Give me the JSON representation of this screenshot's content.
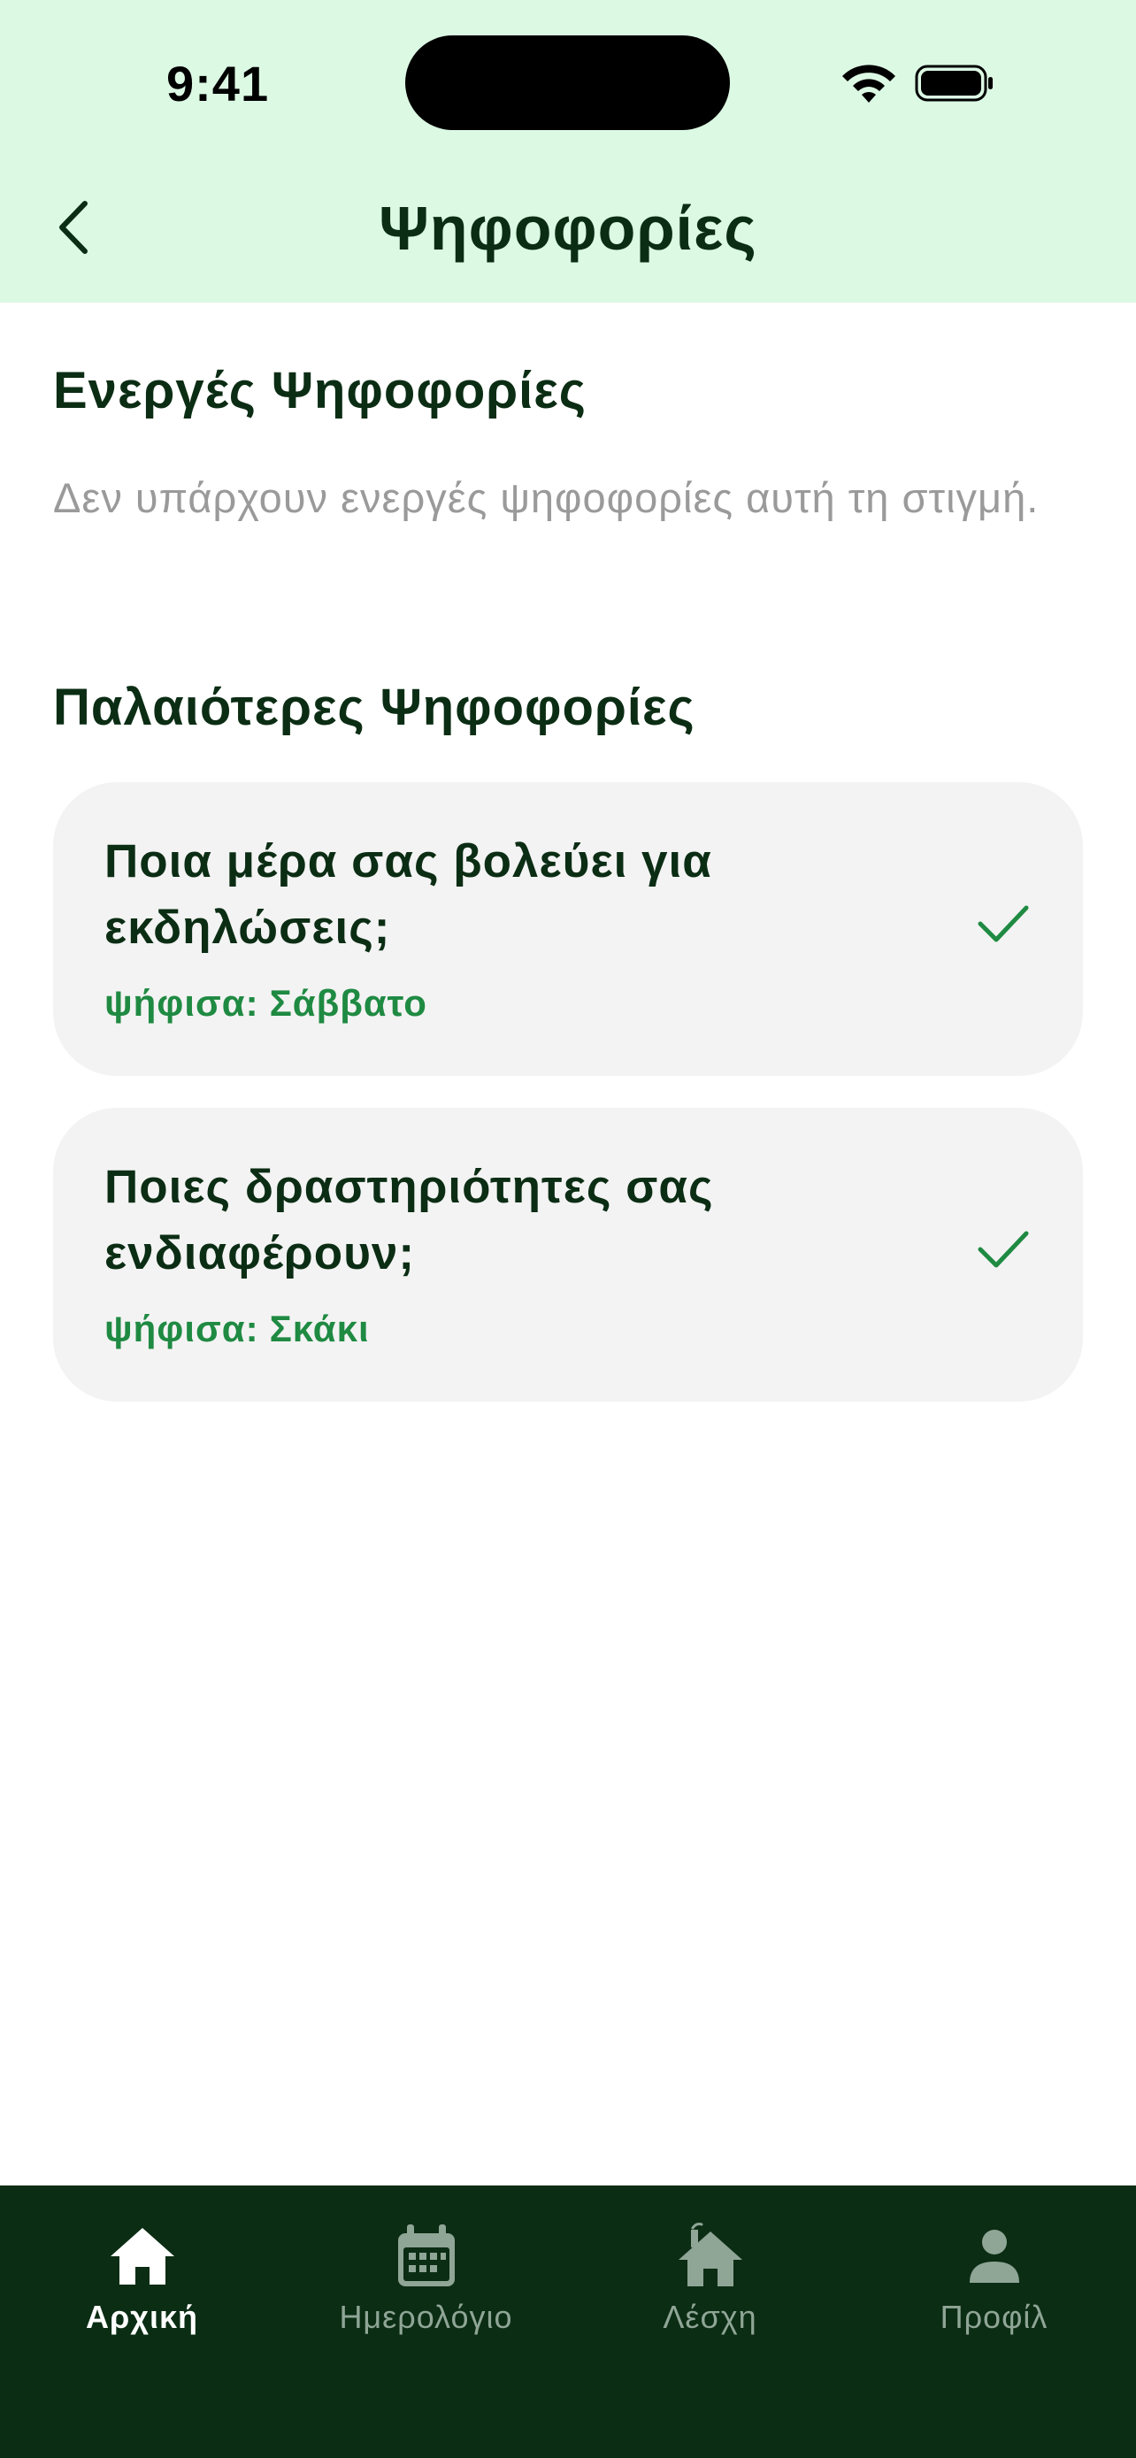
{
  "status_bar": {
    "time": "9:41"
  },
  "header": {
    "title": "Ψηφοφορίες"
  },
  "active_section": {
    "title": "Ενεργές Ψηφοφορίες",
    "empty_message": "Δεν υπάρχουν ενεργές ψηφοφορίες αυτή τη στιγμή."
  },
  "past_section": {
    "title": "Παλαιότερες Ψηφοφορίες",
    "polls": [
      {
        "question": "Ποια μέρα σας βολεύει για εκδηλώσεις;",
        "answer_prefix": "ψήφισα:",
        "answer": "Σάββατο"
      },
      {
        "question": "Ποιες δραστηριότητες σας ενδιαφέρουν;",
        "answer_prefix": "ψήφισα:",
        "answer": "Σκάκι"
      }
    ]
  },
  "tabbar": {
    "items": [
      {
        "label": "Αρχική",
        "icon": "home-icon",
        "active": true
      },
      {
        "label": "Ημερολόγιο",
        "icon": "calendar-icon",
        "active": false
      },
      {
        "label": "Λέσχη",
        "icon": "clubhouse-icon",
        "active": false
      },
      {
        "label": "Προφίλ",
        "icon": "profile-icon",
        "active": false
      }
    ]
  },
  "colors": {
    "header_bg": "#dcf9e4",
    "text_dark": "#0b2d14",
    "accent_green": "#1f8a42",
    "card_bg": "#f3f3f3",
    "tabbar_bg": "#0b2d14"
  }
}
